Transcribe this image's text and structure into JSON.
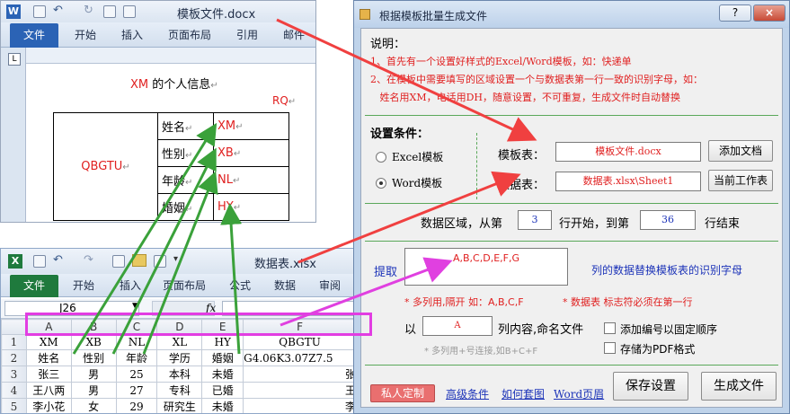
{
  "word": {
    "title": "模板文件.docx",
    "tabs": [
      "文件",
      "开始",
      "插入",
      "页面布局",
      "引用",
      "邮件"
    ],
    "heading_var": "XM",
    "heading_rest": " 的个人信息",
    "rq": "RQ",
    "photo_var": "QBGTU",
    "rows": [
      {
        "label": "姓名",
        "value": "XM"
      },
      {
        "label": "性别",
        "value": "XB"
      },
      {
        "label": "年龄",
        "value": "NL"
      },
      {
        "label": "婚姻",
        "value": "HY"
      }
    ]
  },
  "excel": {
    "title": "数据表.xlsx",
    "tabs": [
      "文件",
      "开始",
      "插入",
      "页面布局",
      "公式",
      "数据",
      "审阅"
    ],
    "namebox": "J26",
    "fx": "fx",
    "columns": [
      "A",
      "B",
      "C",
      "D",
      "E",
      "F"
    ],
    "rows": [
      {
        "num": "1",
        "cells": [
          "XM",
          "XB",
          "NL",
          "XL",
          "HY",
          "QBGTU"
        ]
      },
      {
        "num": "2",
        "cells": [
          "姓名",
          "性别",
          "年龄",
          "学历",
          "婚姻",
          "G4.06K3.07Z7.5"
        ]
      },
      {
        "num": "3",
        "cells": [
          "张三",
          "男",
          "25",
          "本科",
          "未婚",
          "张"
        ]
      },
      {
        "num": "4",
        "cells": [
          "王八两",
          "男",
          "27",
          "专科",
          "已婚",
          "王"
        ]
      },
      {
        "num": "5",
        "cells": [
          "李小花",
          "女",
          "29",
          "研究生",
          "未婚",
          "李"
        ]
      }
    ]
  },
  "dialog": {
    "title": "根据模板批量生成文件",
    "help_button": "?",
    "close_button": "×",
    "explain_title": "说明：",
    "explain_lines": [
      "1、首先有一个设置好样式的Excel/Word模板，如：快递单",
      "2、在模板中需要填写的区域设置一个与数据表第一行一致的识别字母，如：",
      "   姓名用XM，电话用DH，随意设置，不可重复，生成文件时自动替换"
    ],
    "settings_title": "设置条件：",
    "radio_excel": "Excel模板",
    "radio_word": "Word模板",
    "template_label": "模板表：",
    "template_value": "模板文件.docx",
    "add_doc_button": "添加文档",
    "data_label": "数据表：",
    "data_value": "数据表.xlsx\\Sheet1",
    "current_sheet_button": "当前工作表",
    "range_prefix": "数据区域，从第",
    "range_start": "3",
    "range_mid": "行开始，到第",
    "range_end": "36",
    "range_suffix": "行结束",
    "extract_label": "提取",
    "extract_value": "A,B,C,D,E,F,G",
    "extract_suffix": "列的数据替换模板表的识别字母",
    "note_multi": "* 多列用,隔开  如：A,B,C,F",
    "note_data": "* 数据表 标志符必须在第一行",
    "name_prefix": "以",
    "name_value": "A",
    "name_suffix": "列内容,命名文件",
    "name_note": "* 多列用+号连接,如B+C+F",
    "check_number": "添加编号以固定顺序",
    "check_pdf": "存储为PDF格式",
    "custom_button": "私人定制",
    "link_advanced": "高级条件",
    "link_howto": "如何套图",
    "link_word": "Word页眉",
    "save_button": "保存设置",
    "generate_button": "生成文件"
  },
  "colors": {
    "accent_red": "#e02020",
    "accent_blue": "#1c33b8",
    "arrow_green": "#3aa13a",
    "arrow_magenta": "#e040e0",
    "highlight_border": "#e23de2",
    "word_file_tab": "#2b63b5",
    "excel_file_tab": "#1f7a3d"
  }
}
